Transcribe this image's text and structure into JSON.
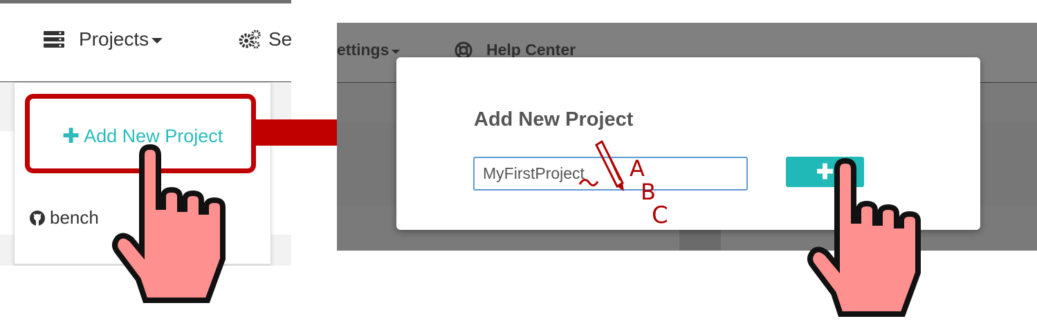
{
  "left_panel": {
    "nav": {
      "projects_label": "Projects",
      "settings_label_partial": "Se"
    },
    "dropdown": {
      "add_new_project_label": "Add New Project",
      "repo_item_partial": "bench"
    }
  },
  "right_panel": {
    "nav": {
      "settings_label_partial": "ettings",
      "help_center_label": "Help Center"
    },
    "modal": {
      "title": "Add New Project",
      "input_value": "MyFirstProject",
      "add_button_icon": "plus-icon"
    }
  },
  "annotation": {
    "letters": [
      "A",
      "B",
      "C"
    ]
  },
  "icons": {
    "projects": "server-stack-icon",
    "settings": "gears-icon",
    "help": "lifebuoy-icon",
    "github": "github-icon",
    "hand_cursor": "pointing-hand-icon",
    "arrow": "arrow-right-icon",
    "pen": "pen-icon"
  },
  "colors": {
    "accent_teal": "#21b8b8",
    "highlight_red": "#c00000",
    "hand_fill": "#ff9090",
    "overlay_gray": "#7a7a7a"
  }
}
